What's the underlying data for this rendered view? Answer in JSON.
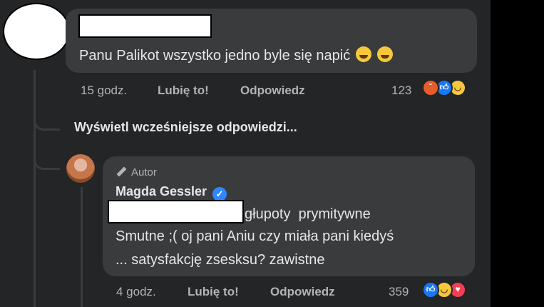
{
  "comment": {
    "text": "Panu Palikot wszystko jedno byle się napić",
    "time": "15 godz.",
    "like_label": "Lubię to!",
    "reply_label": "Odpowiedz",
    "reaction_count": "123",
    "reactions": [
      "angry",
      "like",
      "haha"
    ]
  },
  "thread": {
    "view_more_label": "Wyświetl wcześniejsze odpowiedzi..."
  },
  "reply": {
    "author_badge": "Autor",
    "author_name": "Magda Gessler",
    "line1": "głupoty  prymitywne",
    "line2": "Smutne ;( oj pani Aniu czy miała pani kiedyś",
    "line3": "... satysfakcję zsesksu? zawistne",
    "time": "4 godz.",
    "like_label": "Lubię to!",
    "reply_label": "Odpowiedz",
    "reaction_count": "359",
    "reactions": [
      "like",
      "haha",
      "love"
    ]
  },
  "colors": {
    "background": "#242526",
    "bubble": "#3a3b3c",
    "text_primary": "#e4e6eb",
    "text_secondary": "#b0b3b8",
    "verified": "#2d88ff"
  }
}
